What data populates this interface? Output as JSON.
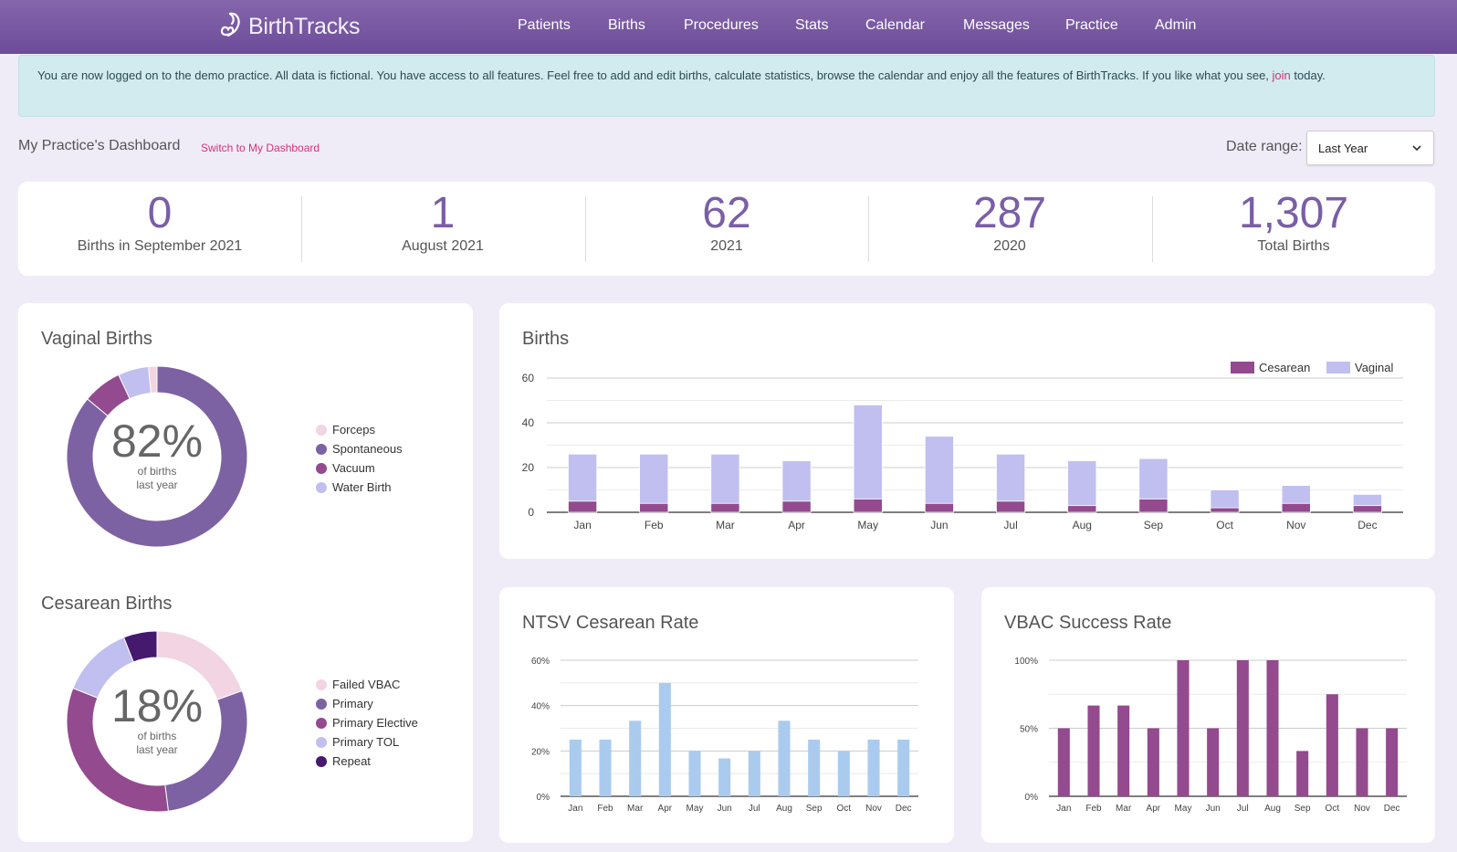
{
  "header": {
    "logo_text": "BirthTracks",
    "nav": [
      "Patients",
      "Births",
      "Procedures",
      "Stats",
      "Calendar",
      "Messages",
      "Practice",
      "Admin"
    ]
  },
  "alert": {
    "text_before": "You are now logged on to the demo practice. All data is fictional. You have access to all features. Feel free to add and edit births, calculate statistics, browse the calendar and enjoy all the features of BirthTracks. If you like what you see, ",
    "link": "join",
    "text_after": " today."
  },
  "dashboard": {
    "title": "My Practice's Dashboard",
    "switch_link": "Switch to My Dashboard",
    "date_range_label": "Date range:",
    "date_range_value": "Last Year"
  },
  "stats": [
    {
      "value": "0",
      "label": "Births in September 2021"
    },
    {
      "value": "1",
      "label": "August 2021"
    },
    {
      "value": "62",
      "label": "2021"
    },
    {
      "value": "287",
      "label": "2020"
    },
    {
      "value": "1,307",
      "label": "Total Births"
    }
  ],
  "colors": {
    "brand": "#7a5ea6",
    "accent_link": "#d6317a",
    "cesarean": "#934a8e",
    "vaginal": "#c0bff0",
    "ntsv_bar": "#aacbee",
    "vbac_bar": "#934a8e"
  },
  "chart_data": [
    {
      "type": "pie",
      "title": "Vaginal Births",
      "center_value": "82%",
      "center_sub1": "of births",
      "center_sub2": "last year",
      "labels": [
        "Forceps",
        "Spontaneous",
        "Vacuum",
        "Water Birth"
      ],
      "colors": [
        "#f2d4e2",
        "#7d62a3",
        "#934a8e",
        "#c0bff0"
      ],
      "order_clockwise_from_top": [
        "Spontaneous",
        "Vacuum",
        "Water Birth",
        "Forceps"
      ],
      "values": [
        1.5,
        86,
        7,
        5.5
      ]
    },
    {
      "type": "pie",
      "title": "Cesarean Births",
      "center_value": "18%",
      "center_sub1": "of births",
      "center_sub2": "last year",
      "labels": [
        "Failed VBAC",
        "Primary",
        "Primary Elective",
        "Primary TOL",
        "Repeat"
      ],
      "colors": [
        "#f2d4e2",
        "#7d62a3",
        "#934a8e",
        "#c0bff0",
        "#45196e"
      ],
      "values": [
        19.5,
        28.5,
        33,
        13,
        6
      ]
    },
    {
      "type": "bar",
      "stacked": true,
      "title": "Births",
      "categories": [
        "Jan",
        "Feb",
        "Mar",
        "Apr",
        "May",
        "Jun",
        "Jul",
        "Aug",
        "Sep",
        "Oct",
        "Nov",
        "Dec"
      ],
      "series": [
        {
          "name": "Cesarean",
          "color": "#934a8e",
          "values": [
            5,
            4,
            4,
            5,
            6,
            4,
            5,
            3,
            6,
            2,
            4,
            3
          ]
        },
        {
          "name": "Vaginal",
          "color": "#c0bff0",
          "values": [
            21,
            22,
            22,
            18,
            42,
            30,
            21,
            20,
            18,
            8,
            8,
            5
          ]
        }
      ],
      "yticks": [
        "0",
        "20",
        "40",
        "60"
      ],
      "ylim": [
        0,
        60
      ],
      "legend": "top-right",
      "grid": true
    },
    {
      "type": "bar",
      "title": "NTSV Cesarean Rate",
      "categories": [
        "Jan",
        "Feb",
        "Mar",
        "Apr",
        "May",
        "Jun",
        "Jul",
        "Aug",
        "Sep",
        "Oct",
        "Nov",
        "Dec"
      ],
      "values": [
        25,
        25,
        33.3,
        50,
        20,
        16.7,
        20,
        33.3,
        25,
        20,
        25,
        25
      ],
      "color": "#aacbee",
      "yticks": [
        "0%",
        "20%",
        "40%",
        "60%"
      ],
      "ylim": [
        0,
        60
      ],
      "grid": true
    },
    {
      "type": "bar",
      "title": "VBAC Success Rate",
      "categories": [
        "Jan",
        "Feb",
        "Mar",
        "Apr",
        "May",
        "Jun",
        "Jul",
        "Aug",
        "Sep",
        "Oct",
        "Nov",
        "Dec"
      ],
      "values": [
        50,
        66.7,
        66.7,
        50,
        100,
        50,
        100,
        100,
        33.3,
        75,
        50,
        50
      ],
      "color": "#934a8e",
      "yticks": [
        "0%",
        "50%",
        "100%"
      ],
      "ylim": [
        0,
        100
      ],
      "grid": true
    }
  ]
}
